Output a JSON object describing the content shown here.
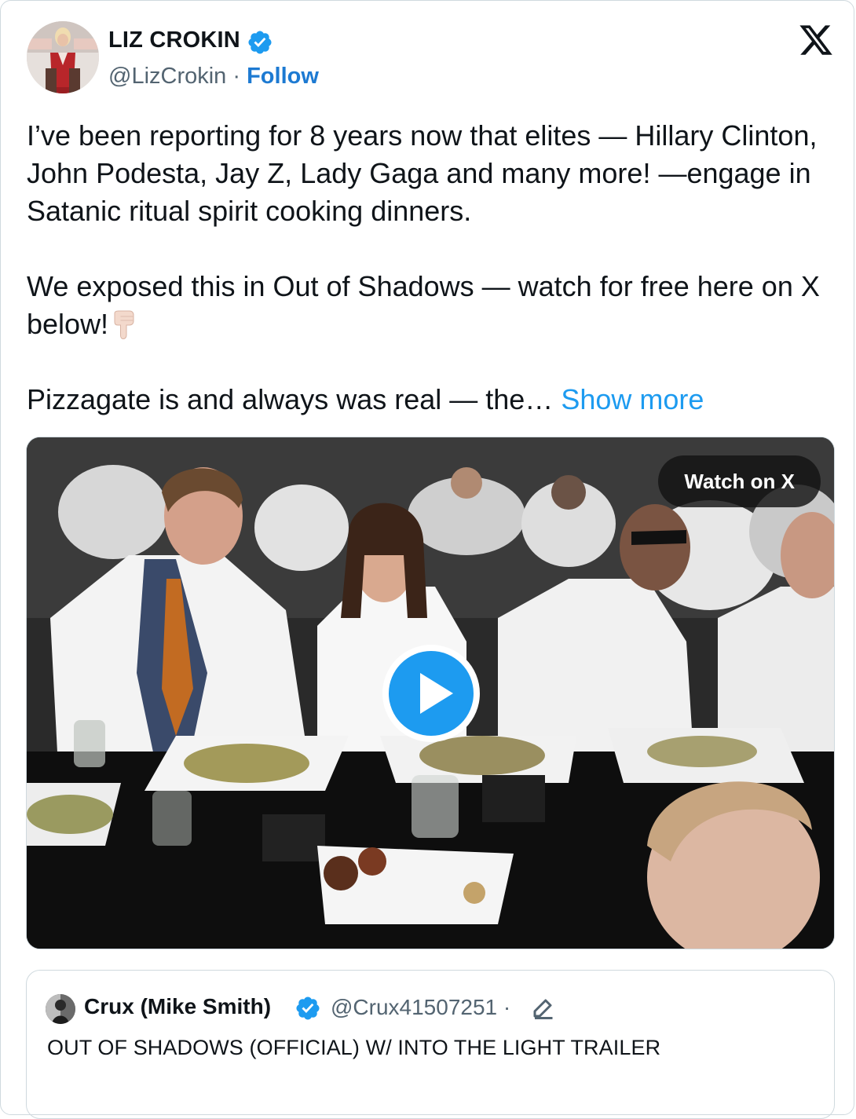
{
  "author": {
    "name": "LIZ CROKIN",
    "handle": "@LizCrokin",
    "separator": " · ",
    "follow_label": "Follow",
    "verified": true,
    "avatar_icon": "profile-photo"
  },
  "brand_icon": "x-logo-icon",
  "tweet": {
    "paragraph_1": "I’ve been reporting for 8 years now that elites — Hillary Clinton, John Podesta, Jay Z, Lady Gaga and many more! —engage in Satanic ritual spirit cooking dinners.",
    "paragraph_2": "We exposed this in Out of Shadows — watch for free here on X below!",
    "paragraph_2_emoji": "backhand-index-pointing-down-icon",
    "paragraph_3": "Pizzagate is and always was real — the…",
    "show_more_label": "Show more"
  },
  "media": {
    "watch_label": "Watch on X",
    "play_icon": "play-icon"
  },
  "quoted_tweet": {
    "name": "Crux (Mike Smith)",
    "handle": "@Crux41507251",
    "separator": " ·",
    "verified": true,
    "edit_icon": "edited-pencil-icon",
    "text": "OUT OF SHADOWS (OFFICIAL) W/ INTO THE LIGHT TRAILER"
  },
  "colors": {
    "link": "#1d9bf0",
    "follow": "#1d7ad2",
    "verified": "#1d9bf0",
    "text": "#0f1419",
    "muted": "#536471",
    "border": "#cfd9de"
  }
}
